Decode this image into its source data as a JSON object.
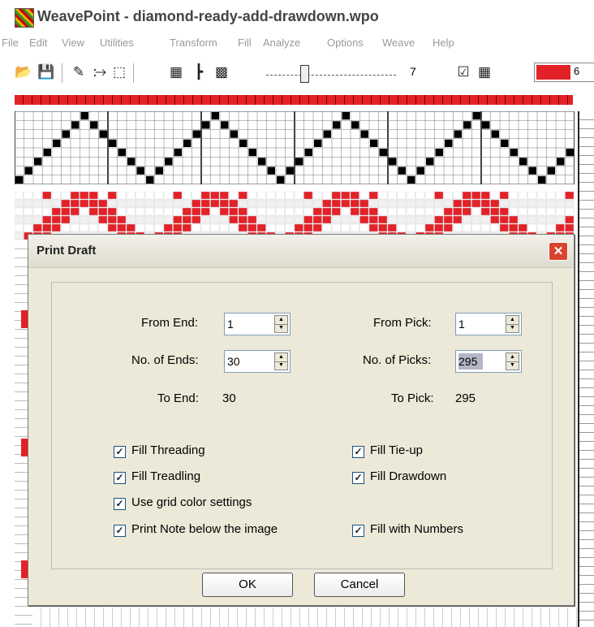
{
  "window": {
    "title": "WeavePoint - diamond-ready-add-drawdown.wpo"
  },
  "menu": [
    "File",
    "Edit",
    "View",
    "Utilities",
    "Transform",
    "Fill",
    "Analyze",
    "Options",
    "Weave",
    "Help"
  ],
  "toolbar": {
    "icons": [
      "open-folder-icon",
      "save-disk-icon",
      "pencil-icon",
      "line-icon",
      "select-icon",
      "tieup-icon",
      "treadle-icon",
      "pattern-icon"
    ],
    "slider_value": "7",
    "color_index": "6",
    "color_hex": "#e32228"
  },
  "dialog": {
    "title": "Print Draft",
    "from_end_label": "From End:",
    "from_end_value": "1",
    "no_ends_label": "No. of Ends:",
    "no_ends_value": "30",
    "to_end_label": "To End:",
    "to_end_value": "30",
    "from_pick_label": "From Pick:",
    "from_pick_value": "1",
    "no_picks_label": "No. of Picks:",
    "no_picks_value": "295",
    "to_pick_label": "To Pick:",
    "to_pick_value": "295",
    "checkboxes": [
      {
        "label": "Fill Threading",
        "checked": true
      },
      {
        "label": "Fill Tie-up",
        "checked": true
      },
      {
        "label": "Fill Treadling",
        "checked": true
      },
      {
        "label": "Fill Drawdown",
        "checked": true
      },
      {
        "label": "Use grid color settings",
        "checked": true
      },
      {
        "label": "Print Note below the image",
        "checked": true
      },
      {
        "label": "Fill with Numbers",
        "checked": true
      }
    ],
    "ok_label": "OK",
    "cancel_label": "Cancel"
  },
  "draft": {
    "ends": 30
  }
}
